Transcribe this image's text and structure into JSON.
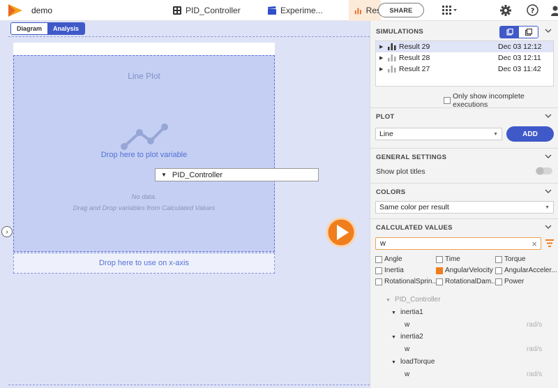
{
  "header": {
    "app_title": "demo",
    "tabs": [
      {
        "label": "PID_Controller",
        "icon": "model-icon"
      },
      {
        "label": "Experime...",
        "icon": "clapperboard-icon"
      },
      {
        "label": "Res",
        "icon": "bar-chart-icon"
      }
    ],
    "share_label": "SHARE",
    "accent_color": "#f07e1c",
    "primary_color": "#3f59c9"
  },
  "view_toggle": {
    "diagram_label": "Diagram",
    "analysis_label": "Analysis"
  },
  "plot": {
    "title": "Line Plot",
    "drop_variable_text": "Drop here to plot variable",
    "no_data_line1": "No data.",
    "no_data_line2": "Drag and Drop variables from Calculated Values",
    "xaxis_drop_text": "Drop here to use on x-axis",
    "drag_item_label": "PID_Controller"
  },
  "panel": {
    "simulations": {
      "heading": "SIMULATIONS",
      "results": [
        {
          "name": "Result 29",
          "date": "Dec 03  12:12",
          "selected": true
        },
        {
          "name": "Result 28",
          "date": "Dec 03  12:11",
          "selected": false
        },
        {
          "name": "Result 27",
          "date": "Dec 03  11:42",
          "selected": false
        }
      ],
      "incomplete_label": "Only show incomplete executions"
    },
    "plot": {
      "heading": "PLOT",
      "type_value": "Line",
      "add_label": "ADD"
    },
    "general": {
      "heading": "GENERAL SETTINGS",
      "show_titles_label": "Show plot titles",
      "show_titles_on": false
    },
    "colors": {
      "heading": "COLORS",
      "value": "Same color per result"
    },
    "calculated": {
      "heading": "CALCULATED VALUES",
      "search_value": "w",
      "filters": [
        {
          "label": "Angle",
          "checked": false
        },
        {
          "label": "Time",
          "checked": false
        },
        {
          "label": "Torque",
          "checked": false
        },
        {
          "label": "Inertia",
          "checked": false
        },
        {
          "label": "AngularVelocity",
          "checked": true
        },
        {
          "label": "AngularAcceler...",
          "checked": false
        },
        {
          "label": "RotationalSprin...",
          "checked": false
        },
        {
          "label": "RotationalDam...",
          "checked": false
        },
        {
          "label": "Power",
          "checked": false
        }
      ],
      "tree": {
        "root": "PID_Controller",
        "nodes": [
          {
            "name": "inertia1",
            "var": "w",
            "unit": "rad/s"
          },
          {
            "name": "inertia2",
            "var": "w",
            "unit": "rad/s"
          },
          {
            "name": "loadTorque",
            "var": "w",
            "unit": "rad/s"
          }
        ]
      }
    }
  }
}
